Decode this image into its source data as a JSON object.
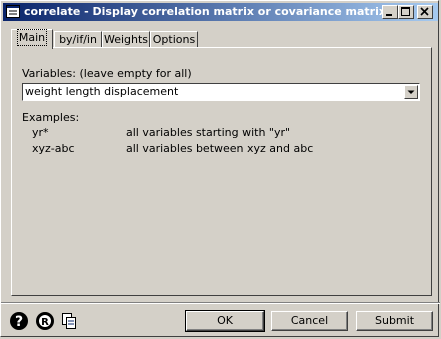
{
  "window": {
    "title": "correlate - Display correlation matrix or covariance matrix",
    "icon": "stata-dialog-icon",
    "controls": [
      "minimize-icon",
      "maximize-icon",
      "close-icon"
    ]
  },
  "tabs": [
    {
      "label": "Main",
      "active": true
    },
    {
      "label": "by/if/in",
      "active": false
    },
    {
      "label": "Weights",
      "active": false
    },
    {
      "label": "Options",
      "active": false
    }
  ],
  "main": {
    "variables_label": "Variables:  (leave empty for all)",
    "variables_value": "weight length displacement",
    "examples_title": "Examples:",
    "examples": [
      {
        "pattern": "yr*",
        "description": "all variables starting with \"yr\""
      },
      {
        "pattern": "xyz-abc",
        "description": "all variables between xyz and abc"
      }
    ]
  },
  "footer": {
    "help_icon": "help-icon",
    "reset_icon": "reset-icon",
    "copy_icon": "copy-command-icon",
    "ok_label": "OK",
    "cancel_label": "Cancel",
    "submit_label": "Submit"
  },
  "colors": {
    "titlebar_start": "#0a246a",
    "titlebar_end": "#a6caf0",
    "face": "#d4d0c8"
  }
}
